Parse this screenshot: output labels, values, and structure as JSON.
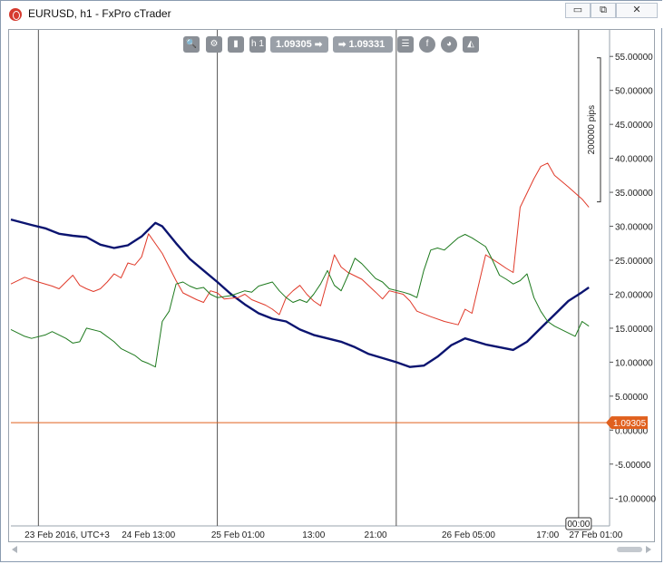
{
  "window": {
    "title": "EURUSD, h1 - FxPro cTrader",
    "minimize_glyph": "▭",
    "restore_glyph": "⧉",
    "close_glyph": "✕"
  },
  "toolbar": {
    "zoom_icon": "zoom-icon",
    "timeframe_label": "h 1",
    "bid_price": "1.09305",
    "ask_price": "1.09331",
    "bid_arrow": "➡",
    "ask_arrow": "➡"
  },
  "chart_data": {
    "type": "line",
    "y_axis": {
      "ticks": [
        "55.00000",
        "50.00000",
        "45.00000",
        "40.00000",
        "35.00000",
        "30.00000",
        "25.00000",
        "20.00000",
        "15.00000",
        "10.00000",
        "5.00000",
        "0.00000",
        "-5.00000",
        "-10.00000"
      ],
      "tick_values": [
        55,
        50,
        45,
        40,
        35,
        30,
        25,
        20,
        15,
        10,
        5,
        0,
        -5,
        -10
      ],
      "ylim": [
        -14.1,
        58.9
      ]
    },
    "scale_label": "200000 pips",
    "x_axis": {
      "labels": [
        "23 Feb 2016, UTC+3",
        "24 Feb 13:00",
        "25 Feb 01:00",
        "13:00",
        "21:00",
        "26 Feb 05:00",
        "17:00",
        "27 Feb 01:00"
      ],
      "label_x_index": [
        2.0,
        20.0,
        33.0,
        44.0,
        53.0,
        66.5,
        78.0,
        85.0
      ],
      "xlim": [
        0,
        87.0
      ],
      "cursor_label": "00:00",
      "cursor_index": 82.5
    },
    "vertical_markers": [
      4.0,
      30.0,
      56.0,
      82.5
    ],
    "current_price": {
      "label": "1.09305",
      "value": 1.1,
      "color": "#e0601e"
    },
    "series": [
      {
        "color": "#0b1470",
        "width": 2.4,
        "points": [
          [
            0,
            31
          ],
          [
            3,
            30.2
          ],
          [
            5,
            29.7
          ],
          [
            7,
            28.9
          ],
          [
            9,
            28.6
          ],
          [
            11,
            28.4
          ],
          [
            13,
            27.3
          ],
          [
            15,
            26.8
          ],
          [
            17,
            27.2
          ],
          [
            19,
            28.5
          ],
          [
            21,
            30.5
          ],
          [
            22,
            30
          ],
          [
            24,
            27.5
          ],
          [
            26,
            25.2
          ],
          [
            28,
            23.5
          ],
          [
            30,
            21.8
          ],
          [
            32,
            20
          ],
          [
            34,
            18.5
          ],
          [
            36,
            17.2
          ],
          [
            38,
            16.4
          ],
          [
            40,
            16
          ],
          [
            42,
            14.8
          ],
          [
            44,
            14
          ],
          [
            46,
            13.5
          ],
          [
            48,
            13
          ],
          [
            50,
            12.2
          ],
          [
            52,
            11.2
          ],
          [
            54,
            10.6
          ],
          [
            56,
            10
          ],
          [
            58,
            9.3
          ],
          [
            60,
            9.5
          ],
          [
            62,
            10.8
          ],
          [
            64,
            12.5
          ],
          [
            66,
            13.5
          ],
          [
            67,
            13.2
          ],
          [
            69,
            12.6
          ],
          [
            71,
            12.2
          ],
          [
            73,
            11.8
          ],
          [
            75,
            13
          ],
          [
            77,
            15
          ],
          [
            79,
            17
          ],
          [
            81,
            19
          ],
          [
            83,
            20.3
          ],
          [
            84,
            21
          ]
        ]
      },
      {
        "color": "#e03a2a",
        "width": 1,
        "points": [
          [
            0,
            21.5
          ],
          [
            2,
            22.5
          ],
          [
            4,
            21.8
          ],
          [
            6,
            21.2
          ],
          [
            7,
            20.8
          ],
          [
            9,
            22.8
          ],
          [
            10,
            21.3
          ],
          [
            11,
            20.8
          ],
          [
            12,
            20.4
          ],
          [
            13,
            20.8
          ],
          [
            14,
            21.8
          ],
          [
            15,
            23
          ],
          [
            16,
            22.4
          ],
          [
            17,
            24.6
          ],
          [
            18,
            24.3
          ],
          [
            19,
            25.5
          ],
          [
            20,
            28.9
          ],
          [
            22,
            26
          ],
          [
            24,
            22
          ],
          [
            25,
            20.2
          ],
          [
            27,
            19.2
          ],
          [
            28,
            18.8
          ],
          [
            29,
            20.5
          ],
          [
            30,
            20.2
          ],
          [
            31,
            19.3
          ],
          [
            33,
            19.5
          ],
          [
            34,
            20
          ],
          [
            35,
            19.2
          ],
          [
            36,
            18.8
          ],
          [
            37,
            18.4
          ],
          [
            38,
            17.8
          ],
          [
            39,
            17
          ],
          [
            40,
            19.5
          ],
          [
            41,
            20.5
          ],
          [
            42,
            21.3
          ],
          [
            43,
            20
          ],
          [
            44,
            19
          ],
          [
            45,
            18.3
          ],
          [
            46,
            22
          ],
          [
            47,
            25.8
          ],
          [
            48,
            24
          ],
          [
            49,
            23.2
          ],
          [
            51,
            22.2
          ],
          [
            53,
            20.3
          ],
          [
            54,
            19.3
          ],
          [
            55,
            20.5
          ],
          [
            57,
            20
          ],
          [
            58,
            19
          ],
          [
            59,
            17.5
          ],
          [
            61,
            16.7
          ],
          [
            63,
            16
          ],
          [
            65,
            15.5
          ],
          [
            66,
            17.8
          ],
          [
            67,
            17.2
          ],
          [
            69,
            25.8
          ],
          [
            71,
            24.5
          ],
          [
            72,
            23.8
          ],
          [
            73,
            23.2
          ],
          [
            74,
            32.8
          ],
          [
            76,
            37
          ],
          [
            77,
            38.8
          ],
          [
            78,
            39.3
          ],
          [
            79,
            37.5
          ],
          [
            81,
            35.8
          ],
          [
            83,
            34
          ],
          [
            84,
            32.8
          ]
        ]
      },
      {
        "color": "#1e7a1e",
        "width": 1,
        "points": [
          [
            0,
            14.8
          ],
          [
            2,
            13.8
          ],
          [
            3,
            13.5
          ],
          [
            5,
            14
          ],
          [
            6,
            14.5
          ],
          [
            8,
            13.5
          ],
          [
            9,
            12.8
          ],
          [
            10,
            13
          ],
          [
            11,
            15
          ],
          [
            13,
            14.5
          ],
          [
            15,
            13
          ],
          [
            16,
            12
          ],
          [
            17,
            11.5
          ],
          [
            18,
            11
          ],
          [
            19,
            10.2
          ],
          [
            20,
            9.8
          ],
          [
            21,
            9.3
          ],
          [
            22,
            16
          ],
          [
            23,
            17.5
          ],
          [
            24,
            21.5
          ],
          [
            25,
            21.8
          ],
          [
            26,
            21.2
          ],
          [
            27,
            20.8
          ],
          [
            28,
            21
          ],
          [
            29,
            20
          ],
          [
            30,
            19.5
          ],
          [
            32,
            19.8
          ],
          [
            34,
            20.5
          ],
          [
            35,
            20.3
          ],
          [
            36,
            21.2
          ],
          [
            38,
            21.8
          ],
          [
            39,
            20.5
          ],
          [
            40,
            19.5
          ],
          [
            41,
            18.8
          ],
          [
            42,
            19.2
          ],
          [
            43,
            18.8
          ],
          [
            44,
            20
          ],
          [
            45,
            21.5
          ],
          [
            46,
            23.5
          ],
          [
            47,
            21.3
          ],
          [
            48,
            20.5
          ],
          [
            49,
            22.8
          ],
          [
            50,
            25.3
          ],
          [
            51,
            24.5
          ],
          [
            53,
            22.3
          ],
          [
            54,
            21.8
          ],
          [
            55,
            20.8
          ],
          [
            57,
            20.3
          ],
          [
            58,
            20
          ],
          [
            59,
            19.5
          ],
          [
            60,
            23.5
          ],
          [
            61,
            26.5
          ],
          [
            62,
            26.8
          ],
          [
            63,
            26.5
          ],
          [
            65,
            28.3
          ],
          [
            66,
            28.8
          ],
          [
            67,
            28.3
          ],
          [
            69,
            27
          ],
          [
            70,
            25
          ],
          [
            71,
            22.8
          ],
          [
            72,
            22.2
          ],
          [
            73,
            21.5
          ],
          [
            74,
            22
          ],
          [
            75,
            23
          ],
          [
            76,
            19.5
          ],
          [
            77,
            17.5
          ],
          [
            78,
            16
          ],
          [
            79,
            15.3
          ],
          [
            80,
            14.8
          ],
          [
            81,
            14.3
          ],
          [
            82,
            13.8
          ],
          [
            83,
            16
          ],
          [
            84,
            15.3
          ]
        ]
      }
    ]
  }
}
